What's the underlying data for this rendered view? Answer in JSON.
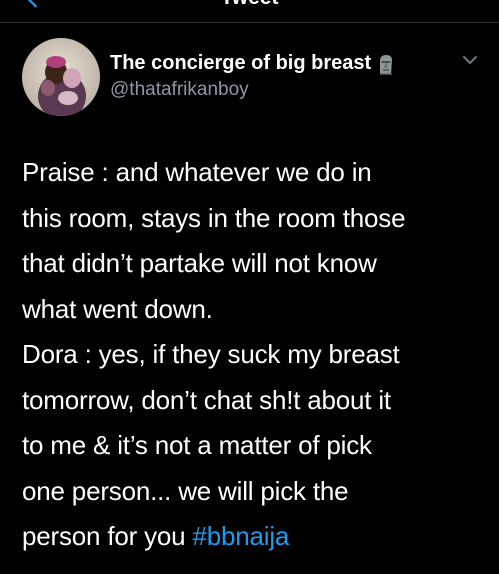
{
  "header": {
    "title": "Tweet"
  },
  "tweet": {
    "author": {
      "display_name": "The concierge of big breast",
      "handle": "@thatafrikanboy",
      "name_emoji": "moai-emoji"
    },
    "lines": [
      "Praise : and whatever we do in",
      "this room, stays in the room those",
      "that didn’t partake will not know",
      "what went down.",
      "Dora : yes, if they suck my breast",
      "tomorrow, don’t chat sh!t about it",
      "to me & it’s not a matter of pick",
      "one person... we will pick the",
      "person for you "
    ],
    "hashtag": "#bbnaija"
  },
  "colors": {
    "background": "#000000",
    "text": "#ffffff",
    "secondary_text": "#8b98a5",
    "link": "#1d9bf0",
    "divider": "#2f3336"
  },
  "icons": {
    "back": "back-arrow-icon",
    "more": "chevron-down-icon"
  }
}
